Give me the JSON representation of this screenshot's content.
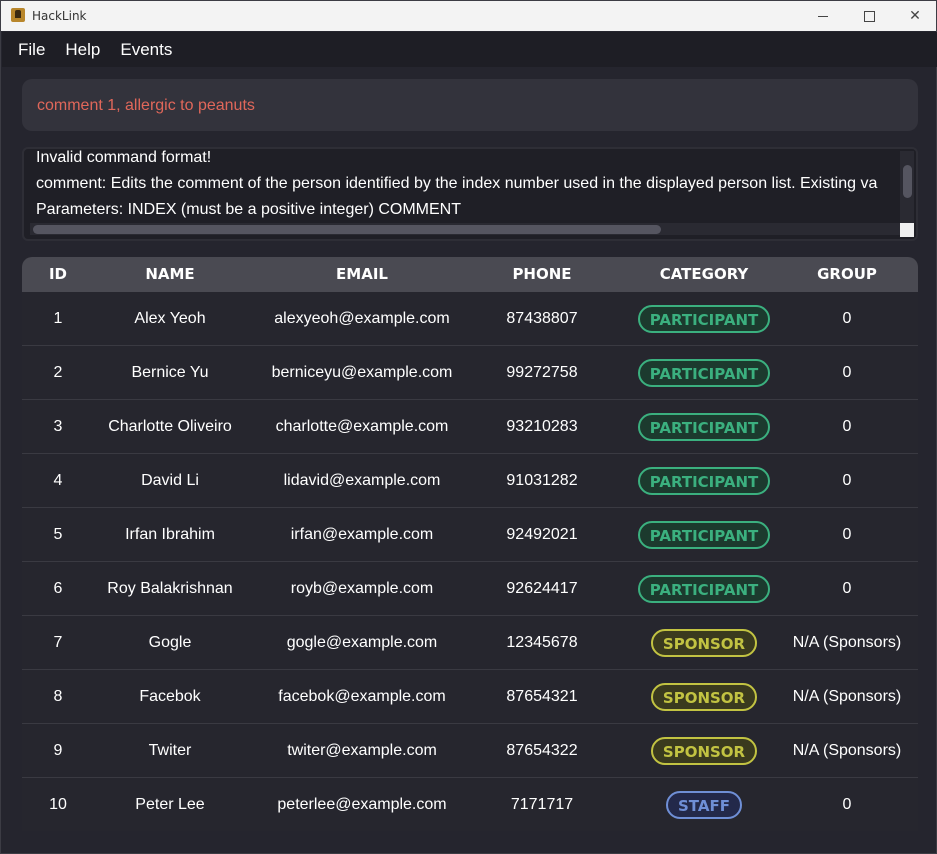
{
  "window": {
    "title": "HackLink"
  },
  "menu": [
    "File",
    "Help",
    "Events"
  ],
  "command": {
    "value": "comment 1, allergic to peanuts"
  },
  "result": {
    "lines": [
      "Invalid command format!",
      "comment: Edits the comment of the person identified by the index number used in the displayed person list. Existing va",
      "Parameters: INDEX (must be a positive integer) COMMENT"
    ]
  },
  "table": {
    "headers": [
      "ID",
      "NAME",
      "EMAIL",
      "PHONE",
      "CATEGORY",
      "GROUP"
    ],
    "rows": [
      {
        "id": "1",
        "name": "Alex Yeoh",
        "email": "alexyeoh@example.com",
        "phone": "87438807",
        "category": "PARTICIPANT",
        "group": "0"
      },
      {
        "id": "2",
        "name": "Bernice Yu",
        "email": "berniceyu@example.com",
        "phone": "99272758",
        "category": "PARTICIPANT",
        "group": "0"
      },
      {
        "id": "3",
        "name": "Charlotte Oliveiro",
        "email": "charlotte@example.com",
        "phone": "93210283",
        "category": "PARTICIPANT",
        "group": "0"
      },
      {
        "id": "4",
        "name": "David Li",
        "email": "lidavid@example.com",
        "phone": "91031282",
        "category": "PARTICIPANT",
        "group": "0"
      },
      {
        "id": "5",
        "name": "Irfan Ibrahim",
        "email": "irfan@example.com",
        "phone": "92492021",
        "category": "PARTICIPANT",
        "group": "0"
      },
      {
        "id": "6",
        "name": "Roy Balakrishnan",
        "email": "royb@example.com",
        "phone": "92624417",
        "category": "PARTICIPANT",
        "group": "0"
      },
      {
        "id": "7",
        "name": "Gogle",
        "email": "gogle@example.com",
        "phone": "12345678",
        "category": "SPONSOR",
        "group": "N/A (Sponsors)"
      },
      {
        "id": "8",
        "name": "Facebok",
        "email": "facebok@example.com",
        "phone": "87654321",
        "category": "SPONSOR",
        "group": "N/A (Sponsors)"
      },
      {
        "id": "9",
        "name": "Twiter",
        "email": "twiter@example.com",
        "phone": "87654322",
        "category": "SPONSOR",
        "group": "N/A (Sponsors)"
      },
      {
        "id": "10",
        "name": "Peter Lee",
        "email": "peterlee@example.com",
        "phone": "7171717",
        "category": "STAFF",
        "group": "0"
      }
    ]
  },
  "colors": {
    "participant": "#3bb07f",
    "sponsor": "#c2c342",
    "staff": "#6f8fd6",
    "command_text": "#e0675a"
  }
}
